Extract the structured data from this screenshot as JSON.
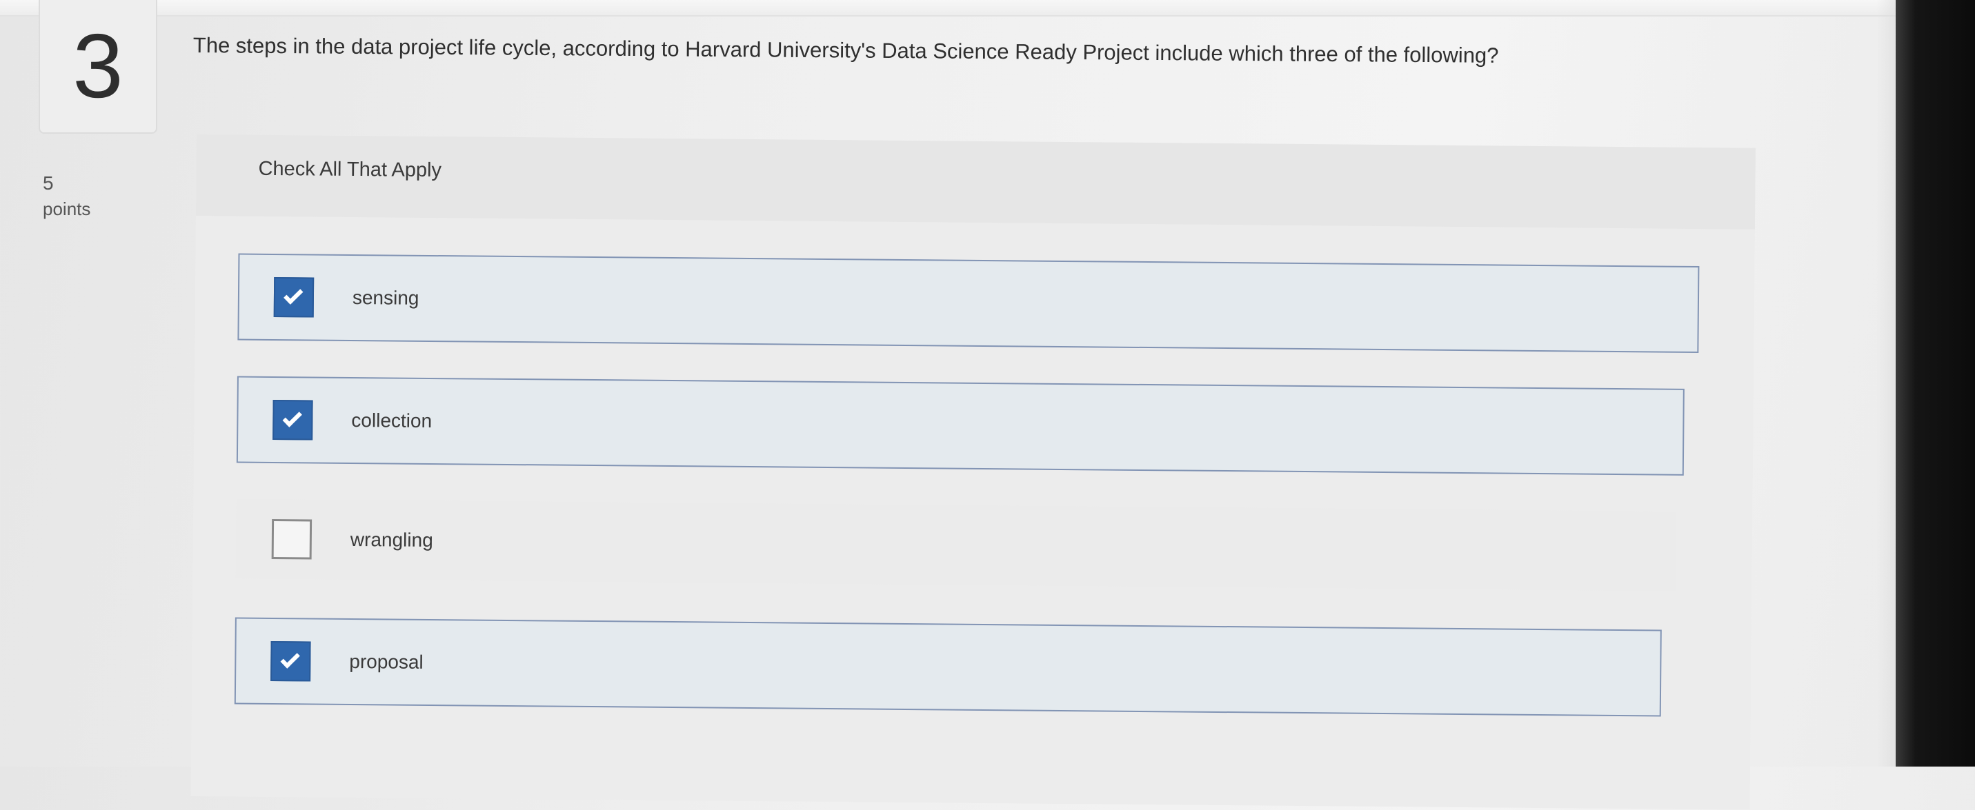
{
  "question": {
    "number": "3",
    "points_value": "5",
    "points_label": "points",
    "text": "The steps in the data project life cycle, according to Harvard University's Data Science Ready Project include which three of the following?",
    "instruction": "Check All That Apply"
  },
  "options": [
    {
      "label": "sensing",
      "checked": true
    },
    {
      "label": "collection",
      "checked": true
    },
    {
      "label": "wrangling",
      "checked": false
    },
    {
      "label": "proposal",
      "checked": true
    }
  ],
  "colors": {
    "checkbox_checked": "#2f67ad",
    "selected_border": "#8294b4",
    "selected_background": "#e4eaee"
  }
}
